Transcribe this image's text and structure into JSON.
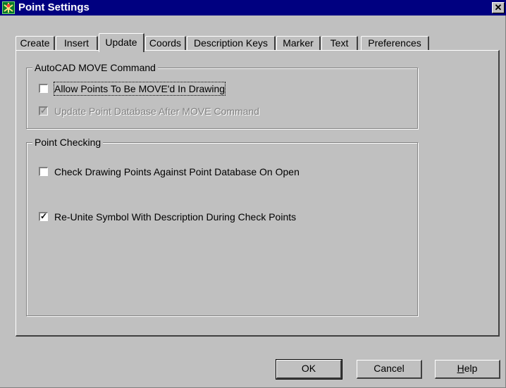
{
  "window": {
    "title": "Point Settings",
    "close_glyph": "✕"
  },
  "tabs": [
    {
      "label": "Create",
      "active": false
    },
    {
      "label": "Insert",
      "active": false
    },
    {
      "label": "Update",
      "active": true
    },
    {
      "label": "Coords",
      "active": false
    },
    {
      "label": "Description Keys",
      "active": false
    },
    {
      "label": "Marker",
      "active": false
    },
    {
      "label": "Text",
      "active": false
    },
    {
      "label": "Preferences",
      "active": false
    }
  ],
  "move_group": {
    "title": "AutoCAD MOVE Command",
    "options": [
      {
        "label": "Allow Points To Be MOVE'd In Drawing",
        "checked": false,
        "enabled": true
      },
      {
        "label": "Update Point Database After MOVE Command",
        "checked": true,
        "enabled": false
      }
    ]
  },
  "checking_group": {
    "title": "Point Checking",
    "options": [
      {
        "label": "Check Drawing Points Against Point Database On Open",
        "checked": false,
        "enabled": true
      },
      {
        "label": "Re-Unite Symbol With Description During Check Points",
        "checked": true,
        "enabled": true
      }
    ]
  },
  "buttons": {
    "ok": "OK",
    "cancel": "Cancel",
    "help_mnemonic": "H",
    "help_rest": "elp"
  },
  "colors": {
    "titlebar": "#000080",
    "face": "#c0c0c0"
  },
  "icons": {
    "app": "surveyor-icon",
    "close": "close-icon",
    "check": "checkmark-icon"
  }
}
